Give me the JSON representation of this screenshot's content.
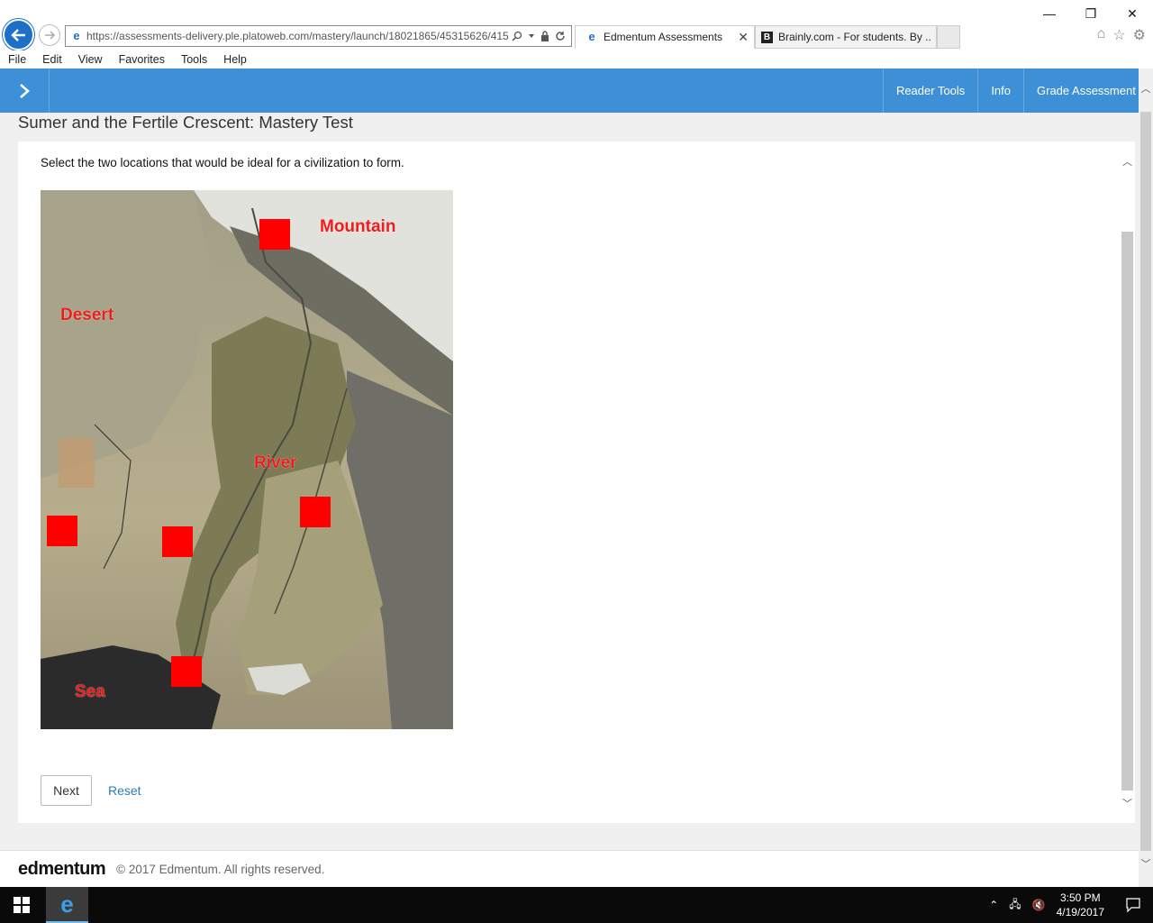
{
  "browser": {
    "url": "https://assessments-delivery.ple.platoweb.com/mastery/launch/18021865/45315626/415",
    "tabs": [
      {
        "label": "Edmentum Assessments",
        "active": true
      },
      {
        "label": "Brainly.com - For students. By ...",
        "active": false
      }
    ],
    "menu": [
      "File",
      "Edit",
      "View",
      "Favorites",
      "Tools",
      "Help"
    ]
  },
  "header": {
    "nav": [
      "Reader Tools",
      "Info",
      "Grade Assessment"
    ],
    "accent": "#3d8fd6"
  },
  "page": {
    "title": "Sumer and the Fertile Crescent: Mastery Test",
    "prompt": "Select the two locations that would be ideal for a civilization to form.",
    "map_labels": {
      "mountain": "Mountain",
      "desert": "Desert",
      "river": "River",
      "sea": "Sea"
    },
    "hotspot_color": "#ff0000",
    "next_label": "Next",
    "reset_label": "Reset"
  },
  "footer": {
    "logo": "edmentum",
    "copyright": "© 2017 Edmentum. All rights reserved."
  },
  "taskbar": {
    "time": "3:50 PM",
    "date": "4/19/2017"
  }
}
